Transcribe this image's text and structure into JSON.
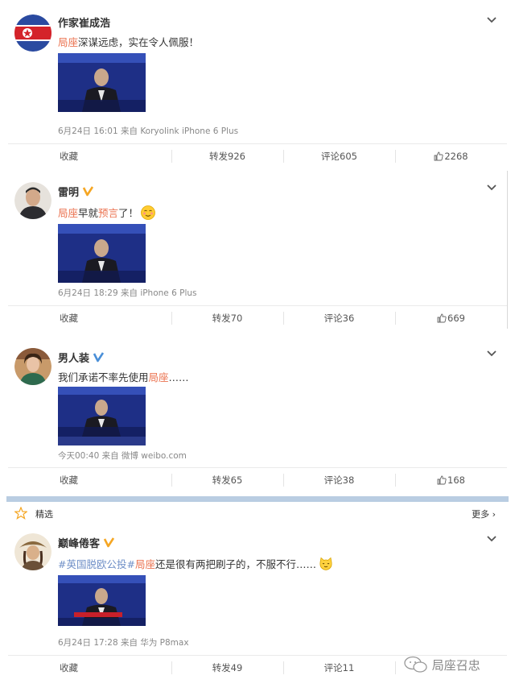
{
  "posts": [
    {
      "username": "作家崔成浩",
      "verified": false,
      "text_parts": [
        {
          "t": "局座",
          "style": "hl"
        },
        {
          "t": "深谋远虑，实在令人佩服！",
          "style": ""
        }
      ],
      "emoji": null,
      "meta": "6月24日 16:01 来自 Koryolink iPhone 6 Plus",
      "actions": {
        "favorite": "收藏",
        "repost": "转发926",
        "comment": "评论605",
        "like": "2268"
      }
    },
    {
      "username": "雷明",
      "verified": true,
      "text_parts": [
        {
          "t": "局座",
          "style": "hl"
        },
        {
          "t": "早就",
          "style": ""
        },
        {
          "t": "预言",
          "style": "hl"
        },
        {
          "t": "了！",
          "style": ""
        }
      ],
      "emoji": "smirk-emoji",
      "meta": "6月24日 18:29 来自 iPhone 6 Plus",
      "actions": {
        "favorite": "收藏",
        "repost": "转发70",
        "comment": "评论36",
        "like": "669"
      }
    },
    {
      "username": "男人装",
      "verified": true,
      "text_parts": [
        {
          "t": "我们承诺不率先使用",
          "style": ""
        },
        {
          "t": "局座",
          "style": "hl"
        },
        {
          "t": "……",
          "style": ""
        }
      ],
      "emoji": null,
      "meta": "今天00:40 来自 微博 weibo.com",
      "actions": {
        "favorite": "收藏",
        "repost": "转发65",
        "comment": "评论38",
        "like": "168"
      }
    },
    {
      "username": "巅峰倦客",
      "verified": true,
      "text_parts": [
        {
          "t": "#英国脱欧公投#",
          "style": "tag"
        },
        {
          "t": "局座",
          "style": "hl"
        },
        {
          "t": "还是很有两把刷子的，不服不行……",
          "style": ""
        }
      ],
      "emoji": "cat-emoji",
      "meta": "6月24日 17:28 来自 华为 P8max",
      "actions": {
        "favorite": "收藏",
        "repost": "转发49",
        "comment": "评论11",
        "like": ""
      }
    }
  ],
  "section": {
    "label": "精选",
    "more": "更多 ›"
  },
  "watermark": "局座召忠",
  "colors": {
    "highlight": "#eb7350",
    "topic": "#6f8fc7",
    "verified": "#f5a623",
    "meta": "#888888",
    "divider": "#b9cde2"
  }
}
